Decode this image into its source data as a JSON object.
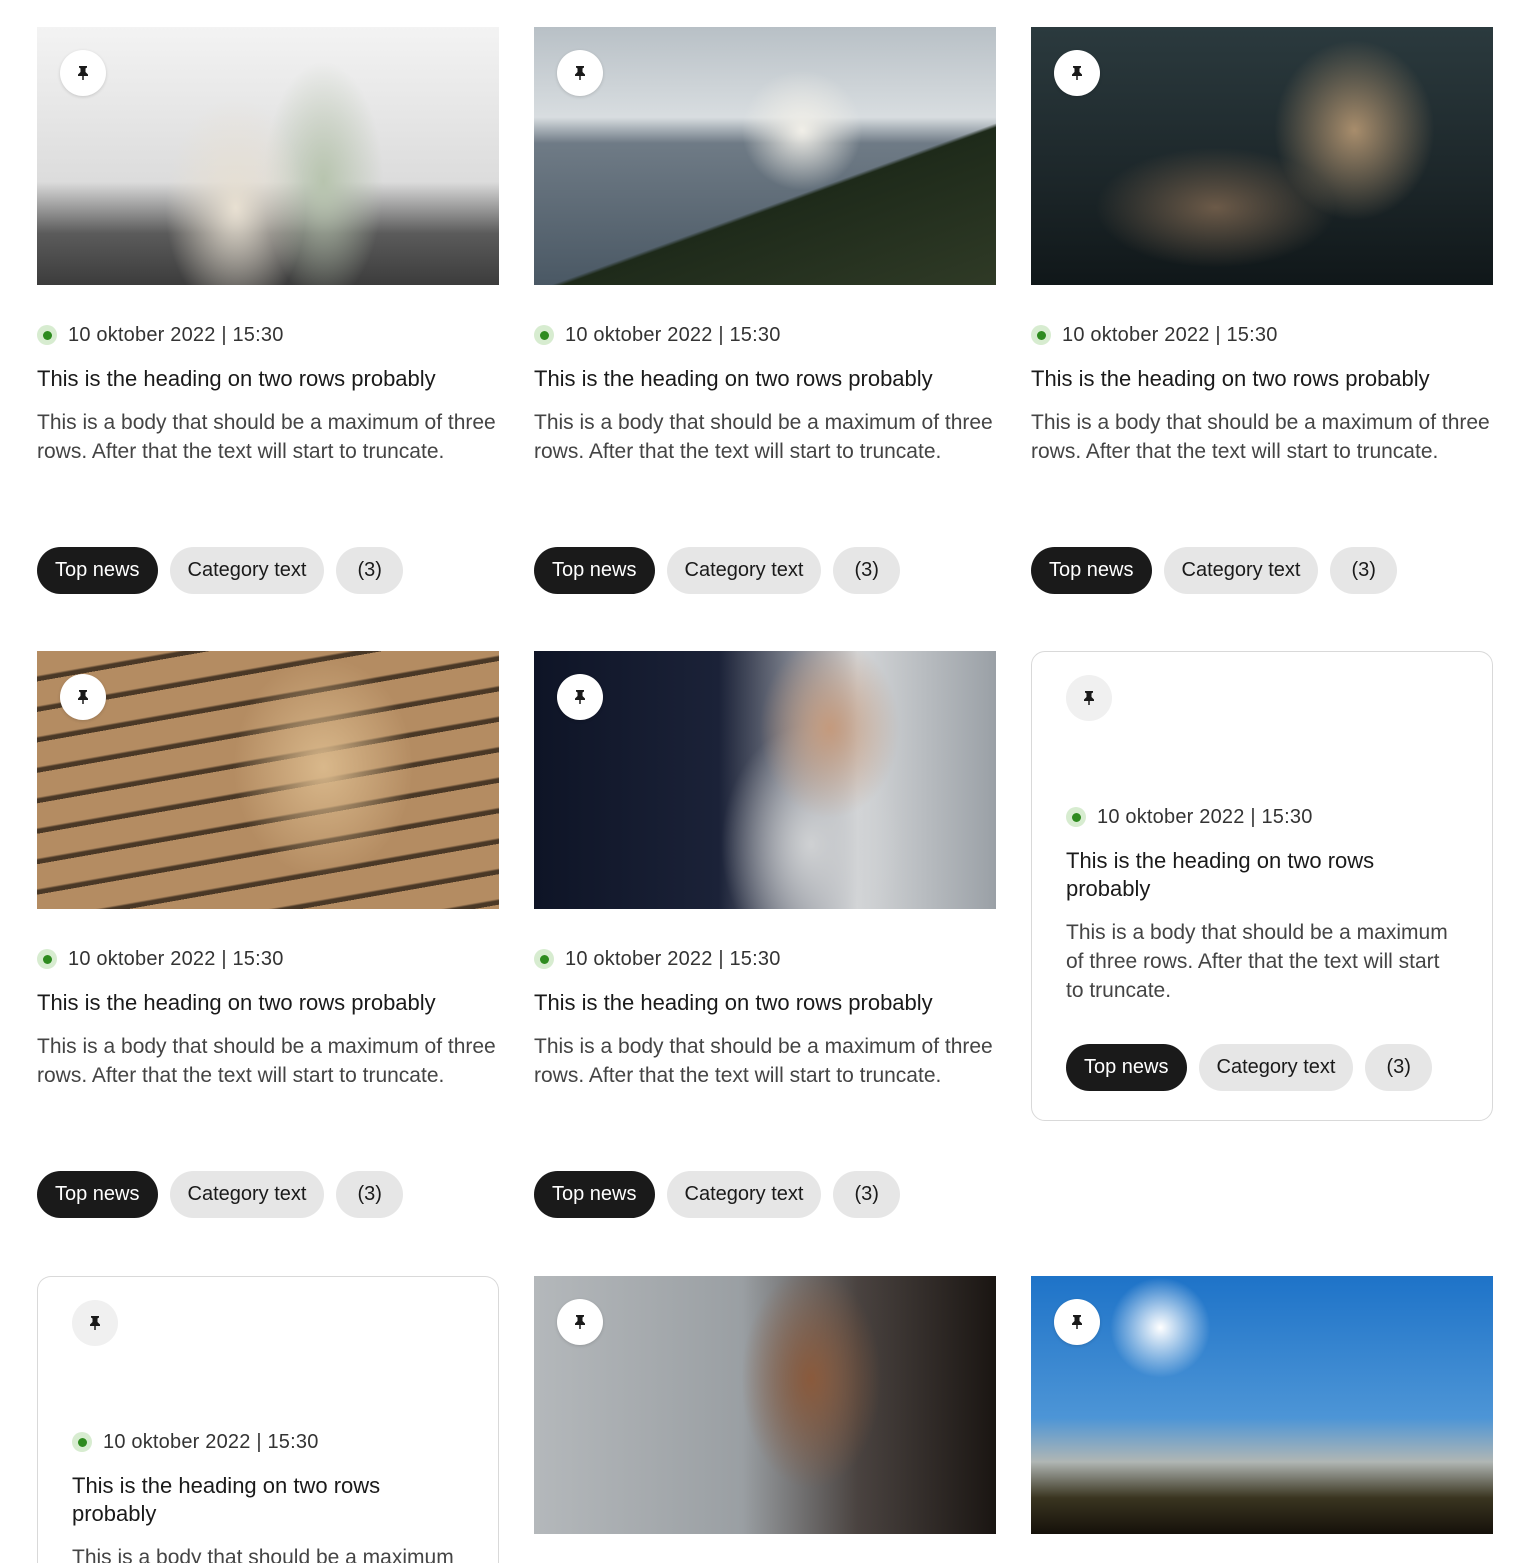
{
  "cards": [
    {
      "variant": "image",
      "image": "couple-in-office-photo",
      "date": "10 oktober 2022 | 15:30",
      "heading": "This is the heading on two rows probably",
      "body": "This is a body that should be a maximum of three rows. After that the text will start to truncate.",
      "tags": [
        "Top news",
        "Category text",
        "(3)"
      ]
    },
    {
      "variant": "image",
      "image": "lake-landscape-photo",
      "date": "10 oktober 2022 | 15:30",
      "heading": "This is the heading on two rows probably",
      "body": "This is a body that should be a maximum of three rows. After that the text will start to truncate.",
      "tags": [
        "Top news",
        "Category text",
        "(3)"
      ]
    },
    {
      "variant": "image",
      "image": "father-daughter-kitchen-photo",
      "date": "10 oktober 2022 | 15:30",
      "heading": "This is the heading on two rows probably",
      "body": "This is a body that should be a maximum of three rows. After that the text will start to truncate.",
      "tags": [
        "Top news",
        "Category text",
        "(3)"
      ]
    },
    {
      "variant": "image",
      "image": "woman-by-wooden-wall-photo",
      "date": "10 oktober 2022 | 15:30",
      "heading": "This is the heading on two rows probably",
      "body": "This is a body that should be a maximum of three rows. After that the text will start to truncate.",
      "tags": [
        "Top news",
        "Category text",
        "(3)"
      ]
    },
    {
      "variant": "image",
      "image": "man-with-tablet-photo",
      "date": "10 oktober 2022 | 15:30",
      "heading": "This is the heading on two rows probably",
      "body": "This is a body that should be a maximum of three rows. After that the text will start to truncate.",
      "tags": [
        "Top news",
        "Category text",
        "(3)"
      ]
    },
    {
      "variant": "boxed",
      "date": "10 oktober 2022 | 15:30",
      "heading": "This is the heading on two rows probably",
      "body": "This is a body that should be a maximum of three rows. After that the text will start to truncate.",
      "tags": [
        "Top news",
        "Category text",
        "(3)"
      ]
    },
    {
      "variant": "boxed",
      "date": "10 oktober 2022 | 15:30",
      "heading": "This is the heading on two rows probably",
      "body": "This is a body that should be a maximum",
      "tags": []
    },
    {
      "variant": "image",
      "image": "man-with-headphones-photo",
      "date": "",
      "heading": "",
      "body": "",
      "tags": []
    },
    {
      "variant": "image",
      "image": "power-lines-sun-photo",
      "date": "",
      "heading": "",
      "body": "",
      "tags": []
    }
  ],
  "icons": {
    "pin": "pin-icon",
    "status": "status-dot-icon"
  },
  "colors": {
    "tag_primary_bg": "#1a1a1a",
    "tag_secondary_bg": "#e6e6e6",
    "status_dot": "#2e8b1f"
  }
}
